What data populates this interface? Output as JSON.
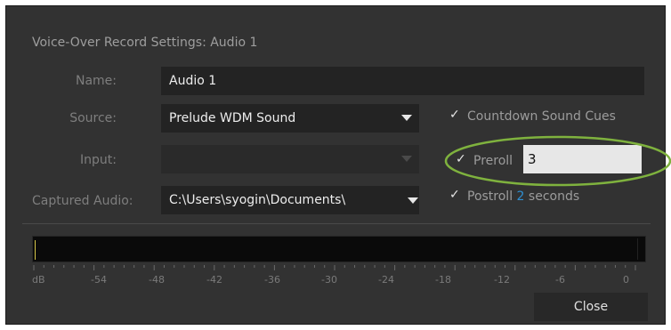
{
  "dialog": {
    "title": "Voice-Over Record Settings: Audio 1"
  },
  "form": {
    "name_label": "Name:",
    "name_value": "Audio 1",
    "source_label": "Source:",
    "source_value": "Prelude WDM Sound",
    "input_label": "Input:",
    "input_value": "",
    "captured_label": "Captured Audio:",
    "captured_value": "C:\\Users\\syogin\\Documents\\"
  },
  "options": {
    "countdown": {
      "checked": true,
      "label": "Countdown Sound Cues"
    },
    "preroll": {
      "checked": true,
      "label": "Preroll",
      "value": "3"
    },
    "postroll": {
      "checked": true,
      "label": "Postroll",
      "value": "2",
      "unit": "seconds"
    }
  },
  "meter": {
    "scale_labels": [
      "dB",
      "-54",
      "-48",
      "-42",
      "-36",
      "-30",
      "-24",
      "-18",
      "-12",
      "-6",
      "0"
    ]
  },
  "buttons": {
    "close_label": "Close"
  },
  "colors": {
    "dialog_bg": "#323232",
    "highlight_ellipse": "#7fb23e",
    "postroll_number": "#2f8fd1"
  }
}
